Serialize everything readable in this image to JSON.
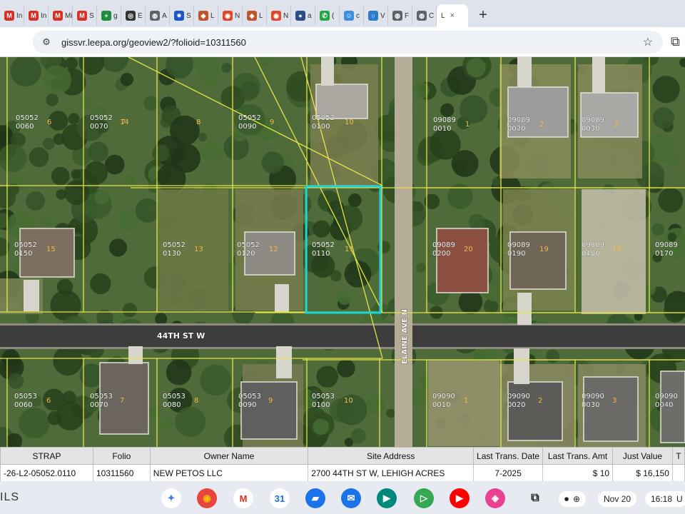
{
  "browser": {
    "tabs": [
      {
        "label": "In",
        "icon": "gmail-icon"
      },
      {
        "label": "In",
        "icon": "gmail-icon"
      },
      {
        "label": "Mi",
        "icon": "gmail-icon"
      },
      {
        "label": "S",
        "icon": "gmail-icon"
      },
      {
        "label": "g",
        "icon": "plus-square-icon"
      },
      {
        "label": "E",
        "icon": "openai-icon"
      },
      {
        "label": "A",
        "icon": "globe-icon"
      },
      {
        "label": "S",
        "icon": "gear-icon"
      },
      {
        "label": "L",
        "icon": "cube-icon"
      },
      {
        "label": "N",
        "icon": "red-circle-icon"
      },
      {
        "label": "L",
        "icon": "cube-icon"
      },
      {
        "label": "N",
        "icon": "red-circle-icon"
      },
      {
        "label": "a",
        "icon": "sphere-icon"
      },
      {
        "label": "(",
        "icon": "whatsapp-icon"
      },
      {
        "label": "c",
        "icon": "smile-icon"
      },
      {
        "label": "V",
        "icon": "ring-icon"
      },
      {
        "label": "F",
        "icon": "globe-icon"
      },
      {
        "label": "C",
        "icon": "globe-icon"
      }
    ],
    "active_tab": {
      "label": "L",
      "close": "×"
    },
    "new_tab": "+",
    "url": "gissvr.leepa.org/geoview2/?folioid=10311560"
  },
  "map": {
    "street_horizontal": "44TH ST W",
    "street_vertical": "ELAINE AVE N",
    "parcels": [
      {
        "code": "05052",
        "sub": "0060",
        "lot": "6"
      },
      {
        "code": "05052",
        "sub": "0070",
        "lot": "7"
      },
      {
        "code": "",
        "sub": "",
        "lot": "8"
      },
      {
        "code": "05052",
        "sub": "0090",
        "lot": "9"
      },
      {
        "code": "05052",
        "sub": "0100",
        "lot": "10"
      },
      {
        "code": "09089",
        "sub": "0010",
        "lot": "1"
      },
      {
        "code": "09089",
        "sub": "0020",
        "lot": "2"
      },
      {
        "code": "09089",
        "sub": "0030",
        "lot": "3"
      },
      {
        "code": "05052",
        "sub": "0150",
        "lot": "15"
      },
      {
        "code": "",
        "sub": "",
        "lot": "14"
      },
      {
        "code": "05052",
        "sub": "0130",
        "lot": "13"
      },
      {
        "code": "05052",
        "sub": "0120",
        "lot": "12"
      },
      {
        "code": "05052",
        "sub": "0110",
        "lot": "11"
      },
      {
        "code": "09089",
        "sub": "0200",
        "lot": "20"
      },
      {
        "code": "09089",
        "sub": "0190",
        "lot": "19"
      },
      {
        "code": "09089",
        "sub": "0180",
        "lot": "18"
      },
      {
        "code": "09089",
        "sub": "0170",
        "lot": ""
      },
      {
        "code": "05053",
        "sub": "0060",
        "lot": "6"
      },
      {
        "code": "05053",
        "sub": "0070",
        "lot": "7"
      },
      {
        "code": "05053",
        "sub": "0080",
        "lot": "8"
      },
      {
        "code": "05053",
        "sub": "0090",
        "lot": "9"
      },
      {
        "code": "05053",
        "sub": "0100",
        "lot": "10"
      },
      {
        "code": "09090",
        "sub": "0010",
        "lot": "1"
      },
      {
        "code": "09090",
        "sub": "0020",
        "lot": "2"
      },
      {
        "code": "09090",
        "sub": "0030",
        "lot": "3"
      },
      {
        "code": "09090",
        "sub": "0040",
        "lot": ""
      }
    ]
  },
  "table": {
    "headers": [
      "STRAP",
      "Folio",
      "Owner Name",
      "Site Address",
      "Last Trans. Date",
      "Last Trans. Amt",
      "Just Value",
      "T"
    ],
    "row": [
      "-26-L2-05052.0110",
      "10311560",
      "NEW PETOS LLC",
      "2700 44TH ST W, LEHIGH ACRES",
      "7-2025",
      "$ 10",
      "$ 16,150",
      ""
    ]
  },
  "taskbar": {
    "shelf_label": "ILS",
    "apps": [
      "gemini-icon",
      "chrome-icon",
      "gmail-icon",
      "calendar-icon",
      "files-icon",
      "messages-icon",
      "meet-icon",
      "play-store-icon",
      "youtube-icon",
      "app-icon"
    ],
    "calendar_day": "31",
    "date": "Nov 20",
    "time": "16:18",
    "tray_suffix": "U"
  },
  "colors": {
    "parcel_line": "#e6e34a",
    "selected_parcel": "#19d3d8",
    "road": "#3d3d3d"
  }
}
